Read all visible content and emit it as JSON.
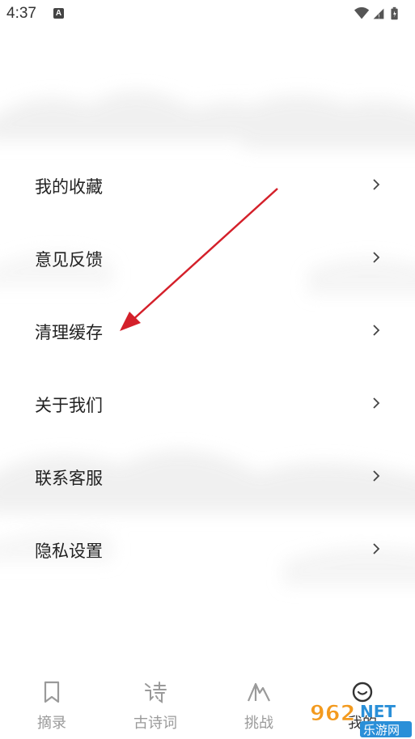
{
  "status_bar": {
    "time": "4:37",
    "notification_icon": "a-icon",
    "icons": [
      "wifi-icon",
      "cellular-icon",
      "battery-icon"
    ]
  },
  "menu": {
    "items": [
      {
        "label": "我的收藏",
        "icon": "chevron-right-icon"
      },
      {
        "label": "意见反馈",
        "icon": "chevron-right-icon"
      },
      {
        "label": "清理缓存",
        "icon": "chevron-right-icon"
      },
      {
        "label": "关于我们",
        "icon": "chevron-right-icon"
      },
      {
        "label": "联系客服",
        "icon": "chevron-right-icon"
      },
      {
        "label": "隐私设置",
        "icon": "chevron-right-icon"
      }
    ]
  },
  "annotation": {
    "color": "#d4202a",
    "points_to": "清理缓存"
  },
  "tabbar": {
    "tabs": [
      {
        "label": "摘录",
        "icon": "bookmark-icon",
        "active": false
      },
      {
        "label": "古诗词",
        "icon": "poem-icon",
        "active": false
      },
      {
        "label": "挑战",
        "icon": "mountain-icon",
        "active": false
      },
      {
        "label": "我的",
        "icon": "smiley-icon",
        "active": true
      }
    ],
    "inactive_color": "#9a9a9a",
    "active_color": "#333333"
  },
  "watermark": {
    "text": "962NET",
    "subtext": "乐游网"
  }
}
